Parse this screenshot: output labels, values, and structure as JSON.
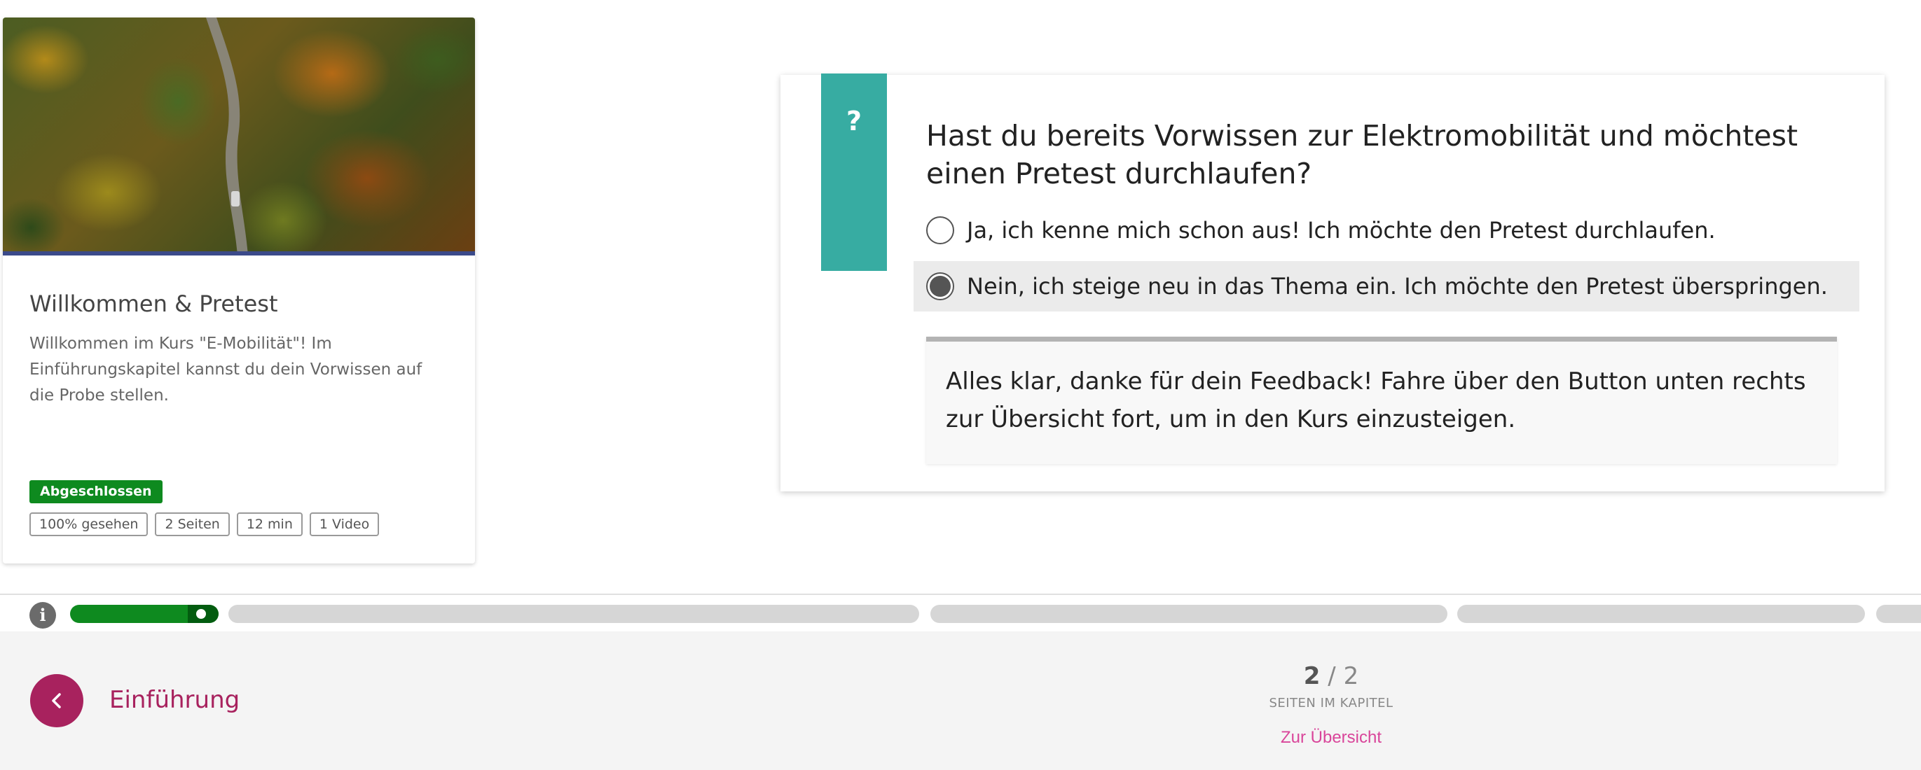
{
  "card": {
    "title": "Willkommen & Pretest",
    "description": "Willkommen im Kurs \"E-Mobilität\"! Im Einführungskapitel kannst du dein Vorwissen auf die Probe stellen.",
    "status_badge": "Abgeschlossen",
    "tags": [
      "100% gesehen",
      "2 Seiten",
      "12 min",
      "1 Video"
    ],
    "colors": {
      "status": "#0e8a1f",
      "image_border": "#3b4a8a"
    }
  },
  "question": {
    "icon": "?",
    "text": "Hast du bereits Vorwissen zur Elektromobilität und möchtest einen Pretest durchlaufen?",
    "options": [
      {
        "label": "Ja, ich kenne mich schon aus! Ich möchte den Pretest durchlaufen.",
        "selected": false
      },
      {
        "label": "Nein, ich steige neu in das Thema ein. Ich möchte den Pretest überspringen.",
        "selected": true
      }
    ],
    "feedback": "Alles klar, danke für dein Feedback! Fahre über den Button unten rechts zur Übersicht fort, um in den Kurs einzusteigen.",
    "colors": {
      "accent": "#37aca2"
    }
  },
  "progress": {
    "info_icon": "info-icon",
    "chapters": 5,
    "current_chapter": 1
  },
  "nav": {
    "back_icon": "chevron-left-icon",
    "chapter": "Einführung",
    "current_page": "2",
    "separator": "/",
    "total_pages": "2",
    "pages_label": "SEITEN IM KAPITEL",
    "overview_link": "Zur Übersicht",
    "colors": {
      "brand": "#a8225e",
      "link": "#d9459a"
    }
  }
}
